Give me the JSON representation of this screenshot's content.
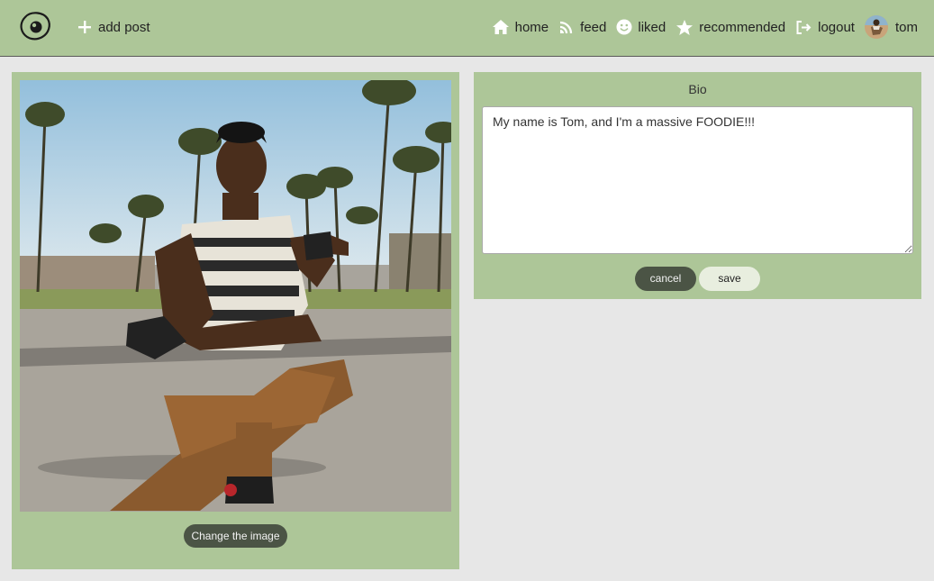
{
  "nav": {
    "logo_icon": "fried-egg-icon",
    "add_post": {
      "label": "add post",
      "icon": "plus-icon"
    },
    "links": [
      {
        "label": "home",
        "icon": "home-icon"
      },
      {
        "label": "feed",
        "icon": "rss-feed-icon"
      },
      {
        "label": "liked",
        "icon": "smiley-icon"
      },
      {
        "label": "recommended",
        "icon": "star-icon"
      },
      {
        "label": "logout",
        "icon": "logout-icon"
      }
    ],
    "user": {
      "name": "tom",
      "avatar": "user-avatar"
    }
  },
  "profile_image": {
    "description": "profile-photo",
    "change_label": "Change the image"
  },
  "bio": {
    "title": "Bio",
    "text": "My name is Tom, and I'm a massive FOODIE!!!",
    "cancel_label": "cancel",
    "save_label": "save"
  },
  "colors": {
    "nav_bg": "#adc698",
    "panel_bg": "#adc698",
    "page_bg": "#e7e7e7",
    "dark_button": "#4b5445",
    "light_button": "#e8eedf"
  }
}
